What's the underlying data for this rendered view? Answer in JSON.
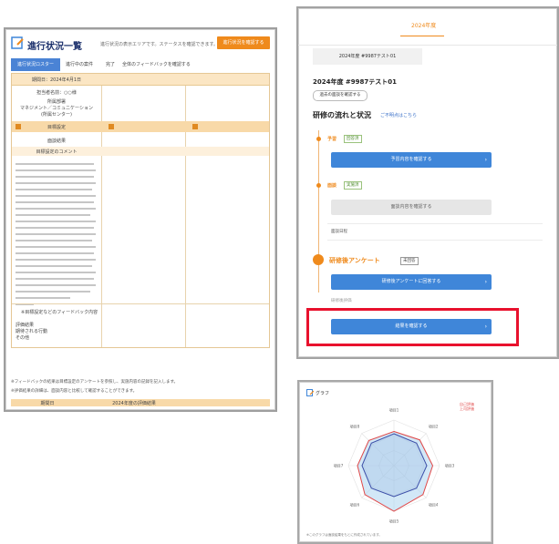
{
  "left_panel": {
    "title": "進行状況一覧",
    "header_note": "進行状況の表示エリアです。ステータスを確認できます。",
    "header_button": "進行状況を確認する",
    "tabs": [
      {
        "label": "進行状況ロスター",
        "active": true
      },
      {
        "label": "進行中の案件"
      },
      {
        "label": "完了"
      },
      {
        "label": "全体のフィードバックを確認する"
      }
    ],
    "band_date": "期間日：2024年4月1日",
    "row_labels": [
      "担当者名前：○○様",
      "所属部署",
      "マネジメント／コミュニケーション",
      "(所属センター)"
    ],
    "section_label": "目標設定",
    "section_label2": "面談結果",
    "section_label3": "目標設定のコメント",
    "bottom_heading": "※目標設定などのフィードバック内容",
    "bottom_rows": [
      "評価結果",
      "期待される行動",
      "その他"
    ],
    "notes": [
      "※フィードバックの結果は目標設定のアンケートを参照し、実施内容の記録を記入します。",
      "※評価結果の詳細は、面談内容と比較して確認することができます。"
    ],
    "footer_cols": [
      "期間日",
      "2024年度の評価結果"
    ],
    "brand_color": "#ef8a1c",
    "tab_color": "#4a83d5"
  },
  "right_top": {
    "year_tab": "2024年度",
    "sub_tab": "2024年度 #9987テスト01",
    "heading": "2024年度 #9987テスト01",
    "chip": "過去の面談を確認する",
    "flow_heading": "研修の流れと状況",
    "flow_link": "ご不明点はこちら",
    "steps": [
      {
        "label": "予習",
        "tag": "回答済",
        "button": "予習内容を確認する"
      },
      {
        "label": "面談",
        "tag": "実施済",
        "button": "面談内容を確認する",
        "note": "面談日程"
      }
    ],
    "survey_heading": "研修後アンケート",
    "survey_tag": "未回答",
    "survey_button": "研修後アンケートに回答する",
    "result_label": "研修後評価",
    "result_button": "結果を確認する",
    "accent_color": "#ef8a1c",
    "button_color": "#3f86d9",
    "highlight_color": "#e8112d"
  },
  "right_bottom": {
    "title": "グラフ",
    "legend": [
      "自己評価",
      "上司評価"
    ],
    "axes": [
      "項目1",
      "項目2",
      "項目3",
      "項目4",
      "項目5",
      "項目6",
      "項目7",
      "項目8"
    ],
    "footer": "※このグラフは面談結果をもとに作成されています。",
    "series_self": [
      0.7,
      0.7,
      0.72,
      0.7,
      0.68,
      0.7,
      0.7,
      0.7
    ],
    "series_boss": [
      0.75,
      0.8,
      0.85,
      0.9,
      1.0,
      0.9,
      0.8,
      0.78
    ]
  }
}
